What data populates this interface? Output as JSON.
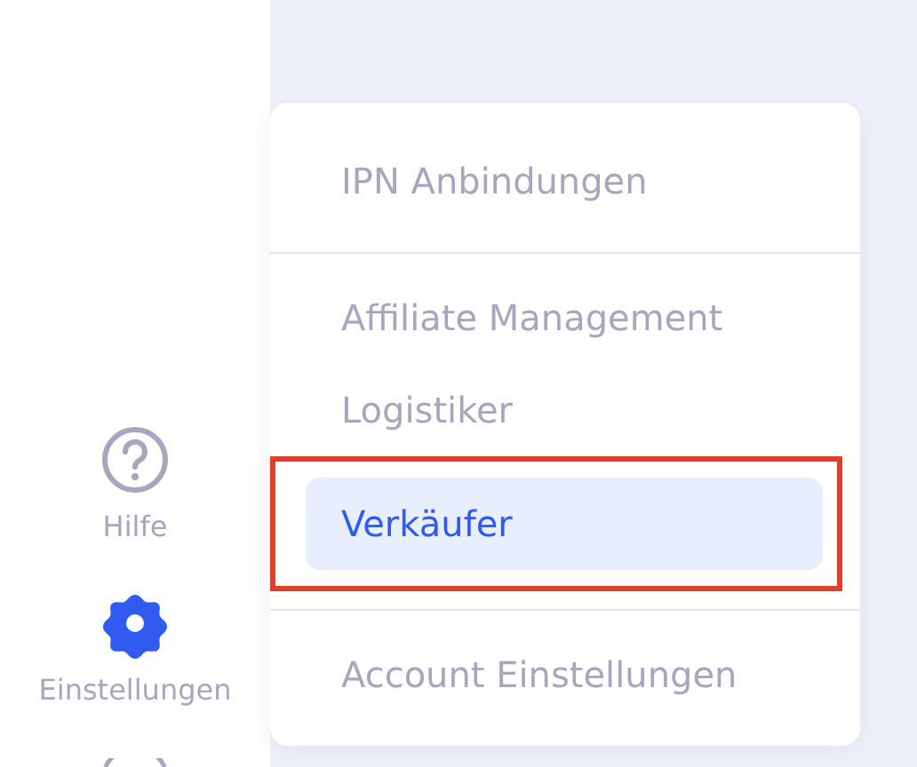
{
  "sidebar": {
    "items": [
      {
        "kind": "help",
        "label": "Hilfe",
        "selected": false
      },
      {
        "kind": "settings",
        "label": "Einstellungen",
        "selected": true
      }
    ]
  },
  "menu": {
    "groups": [
      {
        "items": [
          {
            "label": "IPN Anbindungen",
            "selected": false
          }
        ]
      },
      {
        "items": [
          {
            "label": "Affiliate Management",
            "selected": false
          },
          {
            "label": "Logistiker",
            "selected": false
          },
          {
            "label": "Verkäufer",
            "selected": true
          }
        ]
      },
      {
        "items": [
          {
            "label": "Account Einstellungen",
            "selected": false
          }
        ]
      }
    ]
  }
}
